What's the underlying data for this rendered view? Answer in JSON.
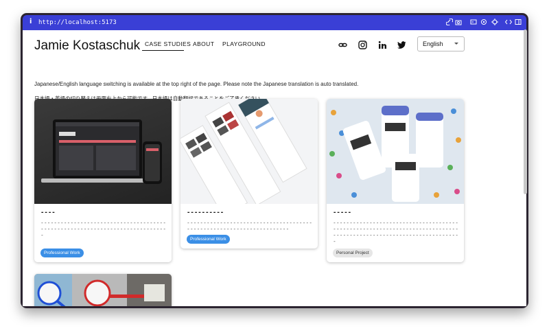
{
  "browser": {
    "info_glyph": "i",
    "url": "http://localhost:5173"
  },
  "header": {
    "logo": "Jamie Kostaschuk",
    "nav": [
      {
        "label": "CASE STUDIES",
        "active": true
      },
      {
        "label": "ABOUT",
        "active": false
      },
      {
        "label": "PLAYGROUND",
        "active": false
      }
    ],
    "social": [
      "link-icon",
      "instagram-icon",
      "linkedin-icon",
      "twitter-icon"
    ],
    "language": "English"
  },
  "notice": {
    "en": "Japanese/English language switching is available at the top right of the page. Please note the Japanese translation is auto translated.",
    "ja": "日本語・英語の切り替えは画面右上から可能です。日本語は自動翻訳であることをご了承ください。"
  },
  "cards": [
    {
      "title": "----",
      "desc": "-----------------------------------------------------------------------------",
      "tag": "Professional Work",
      "tag_color": "#3b8fe6"
    },
    {
      "title": "----------",
      "desc": "---------------------------------------------------------------------",
      "tag": "Professional Work",
      "tag_color": "#3b8fe6"
    },
    {
      "title": "-----",
      "desc": "-------------------------------------------------------------------------------------------------------------------",
      "tag": "Personal Project",
      "tag_color": "#e6e6e6"
    }
  ],
  "colors": {
    "browser_bar": "#3a3fd6",
    "frame": "#2b2430",
    "tag_blue": "#3b8fe6"
  }
}
